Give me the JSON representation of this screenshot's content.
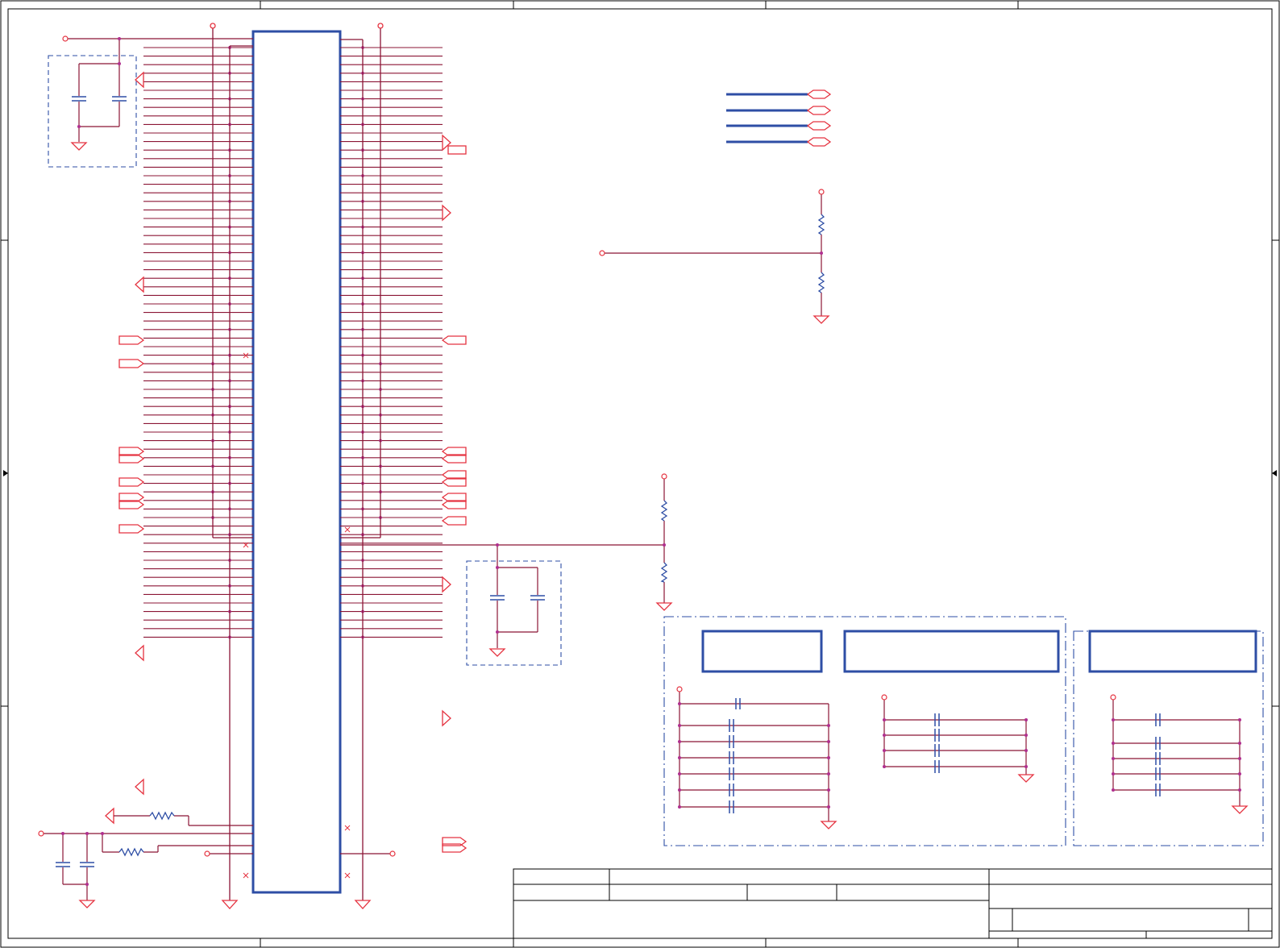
{
  "title": "",
  "colors": {
    "wire": "#8b1535",
    "symbol": "#e53340",
    "junction": "#b02f8f",
    "outline": "#2e4ea5",
    "frame": "#000000"
  },
  "connector": {
    "left_pin_rows": 70,
    "right_pin_rows": 70
  },
  "title_block": {
    "fields": []
  }
}
